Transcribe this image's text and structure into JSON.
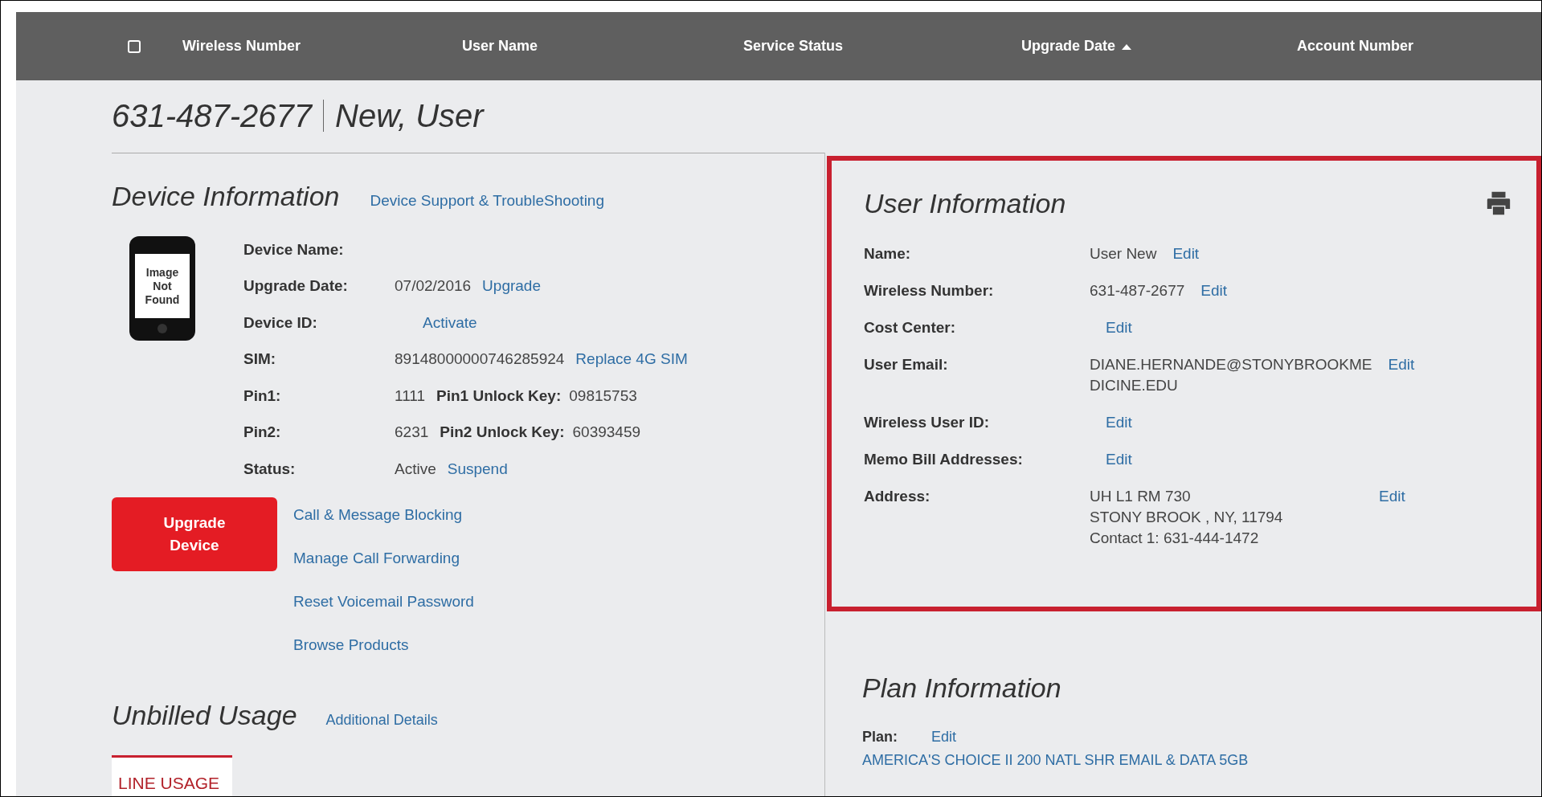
{
  "header": {
    "checkbox": {
      "checked": false
    },
    "columns": [
      {
        "label": "Wireless Number",
        "sorted": false
      },
      {
        "label": "User Name",
        "sorted": false
      },
      {
        "label": "Service Status",
        "sorted": false
      },
      {
        "label": "Upgrade Date",
        "sorted": true
      },
      {
        "label": "Account Number",
        "sorted": false
      }
    ]
  },
  "title": {
    "number": "631-487-2677",
    "name": "New, User"
  },
  "device_information": {
    "heading": "Device Information",
    "link": "Device Support & TroubleShooting",
    "image_placeholder": "Image Not Found",
    "fields": [
      {
        "label": "Device Name:"
      },
      {
        "label": "Upgrade Date:",
        "value": "07/02/2016",
        "link": "Upgrade"
      },
      {
        "label": "Device ID:",
        "link": "Activate"
      },
      {
        "label": "SIM:",
        "value": "89148000000746285924",
        "link": "Replace 4G SIM"
      },
      {
        "label": "Pin1:",
        "value": "1111",
        "key_label": "Pin1 Unlock Key:",
        "key_value": "09815753"
      },
      {
        "label": "Pin2:",
        "value": "6231",
        "key_label": "Pin2 Unlock Key:",
        "key_value": "60393459"
      },
      {
        "label": "Status:",
        "value": "Active",
        "link": "Suspend"
      }
    ],
    "upgrade_button": "Upgrade Device",
    "actions": [
      "Call & Message Blocking",
      "Manage Call Forwarding",
      "Reset Voicemail Password",
      "Browse Products"
    ]
  },
  "unbilled_usage": {
    "heading": "Unbilled Usage",
    "link": "Additional Details",
    "tabs": [
      {
        "label": "LINE USAGE",
        "selected": true
      }
    ]
  },
  "user_information": {
    "heading": "User Information",
    "highlighted": true,
    "fields": [
      {
        "label": "Name:",
        "value_lines": [
          "User New"
        ],
        "edit": "Edit"
      },
      {
        "label": "Wireless Number:",
        "value_lines": [
          "631-487-2677"
        ],
        "edit": "Edit"
      },
      {
        "label": "Cost Center:",
        "edit": "Edit"
      },
      {
        "label": "User Email:",
        "value_lines": [
          "DIANE.HERNANDE@STONYBROOKME",
          "DICINE.EDU"
        ],
        "edit": "Edit"
      },
      {
        "label": "Wireless User ID:",
        "edit": "Edit"
      },
      {
        "label": "Memo Bill Addresses:",
        "edit": "Edit"
      },
      {
        "label": "Address:",
        "value_lines": [
          "UH L1 RM 730",
          "STONY BROOK , NY, 11794",
          "Contact 1: 631-444-1472"
        ],
        "edit": "Edit"
      }
    ]
  },
  "plan_information": {
    "heading": "Plan Information",
    "label": "Plan:",
    "edit": "Edit",
    "plan": "AMERICA'S CHOICE II 200 NATL SHR EMAIL & DATA 5GB"
  }
}
